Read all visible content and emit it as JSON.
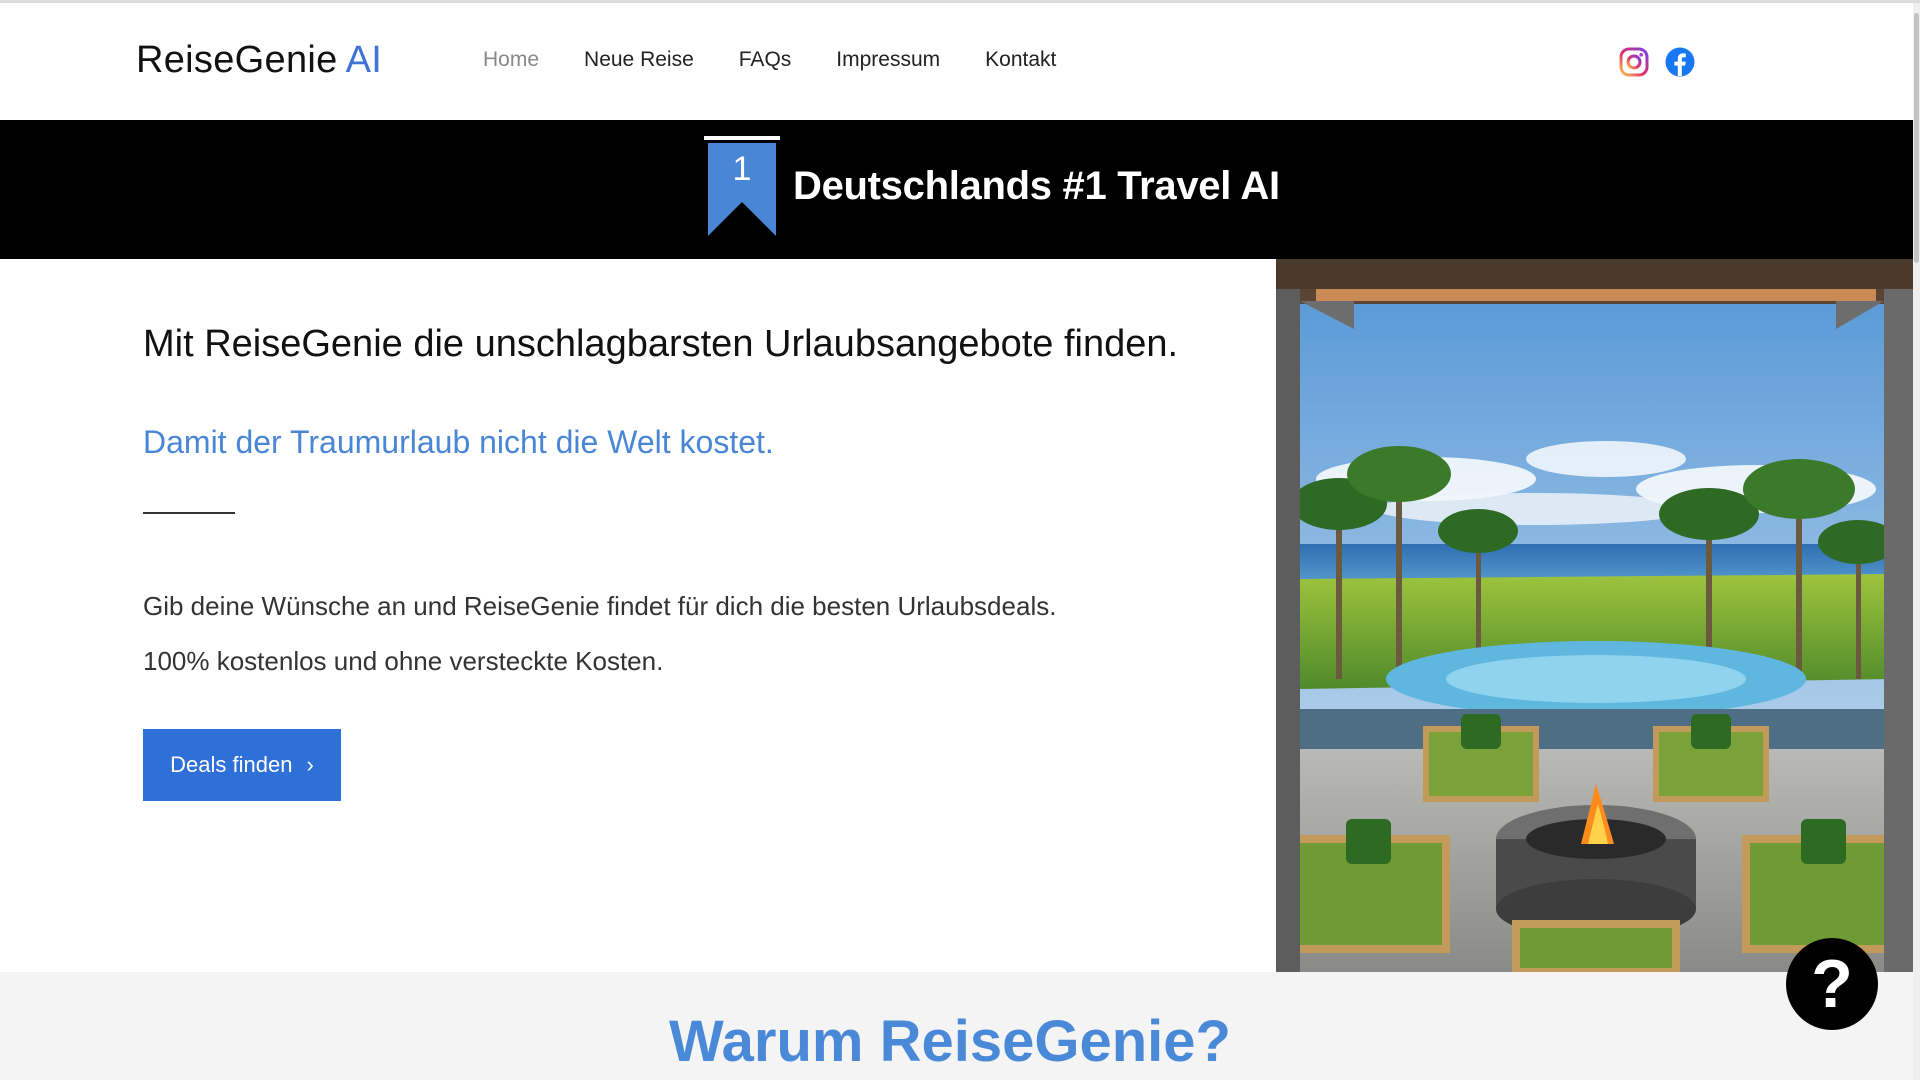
{
  "header": {
    "logo_main": "ReiseGenie",
    "logo_accent": "AI",
    "nav": [
      {
        "label": "Home",
        "active": true
      },
      {
        "label": "Neue Reise"
      },
      {
        "label": "FAQs"
      },
      {
        "label": "Impressum"
      },
      {
        "label": "Kontakt"
      }
    ],
    "social": [
      "instagram-icon",
      "facebook-icon"
    ]
  },
  "banner": {
    "rank": "1",
    "title": "Deutschlands #1 Travel AI"
  },
  "hero": {
    "headline": "Mit ReiseGenie die unschlagbarsten Urlaubsangebote finden.",
    "subline": "Damit der Traumurlaub nicht die Welt kostet.",
    "desc_line1": "Gib deine Wünsche an und ReiseGenie findet für dich die besten Urlaubsdeals.",
    "desc_line2": "100% kostenlos und ohne versteckte Kosten.",
    "cta_label": "Deals finden"
  },
  "section": {
    "title": "Warum ReiseGenie?"
  },
  "help": {
    "label": "?"
  },
  "colors": {
    "brand_blue": "#3f73d6",
    "cta_blue": "#2f6fd8",
    "subline_blue": "#4a86d6",
    "banner_black": "#000000"
  }
}
